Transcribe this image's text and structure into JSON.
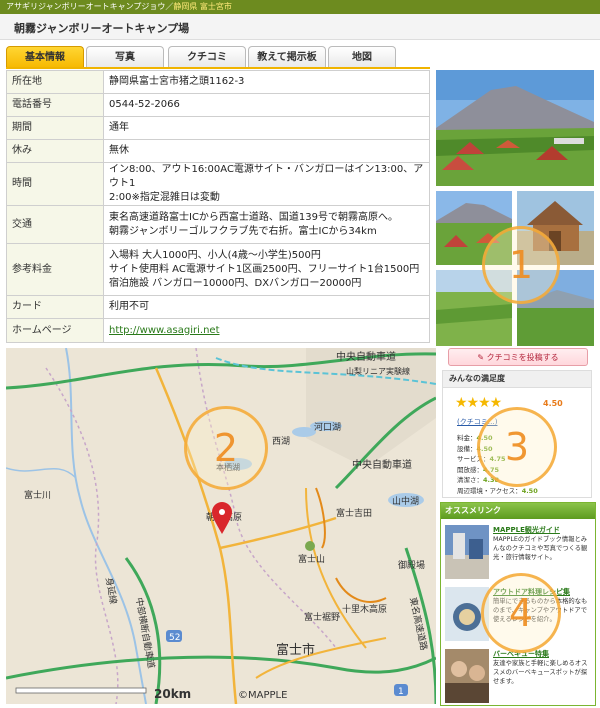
{
  "breadcrumb": {
    "site": "アサギリジャンボリーオートキャンプジョウ",
    "sep": "／",
    "link": "静岡県 富士宮市"
  },
  "page_title": "朝霧ジャンボリーオートキャンプ場",
  "tabs": [
    {
      "label": "基本情報",
      "active": true
    },
    {
      "label": "写真"
    },
    {
      "label": "クチコミ"
    },
    {
      "label": "教えて掲示板"
    },
    {
      "label": "地図"
    }
  ],
  "info": {
    "address_label": "所在地",
    "address_value": "静岡県富士宮市猪之頭1162-3",
    "phone_label": "電話番号",
    "phone_value": "0544-52-2066",
    "period_label": "期間",
    "period_value": "通年",
    "closed_label": "休み",
    "closed_value": "無休",
    "time_label": "時間",
    "time_line1": "イン8:00、アウト16:00AC電源サイト・バンガローはイン13:00、アウト1",
    "time_line2": "2:00※指定混雑日は変動",
    "access_label": "交通",
    "access_line1": "東名高速道路富士ICから西富士道路、国道139号で朝霧高原へ。",
    "access_line2": "朝霧ジャンボリーゴルフクラブ先で右折。富士ICから34km",
    "fee_label": "参考料金",
    "fee_line1": "入場料 大人1000円、小人(4歳～小学生)500円",
    "fee_line2": "サイト使用料 AC電源サイト1区画2500円、フリーサイト1台1500円",
    "fee_line3": "宿泊施設 バンガロー10000円、DXバンガロー20000円",
    "card_label": "カード",
    "card_value": "利用不可",
    "homepage_label": "ホームページ",
    "homepage_value": "http://www.asagiri.net"
  },
  "badges": {
    "one": "1",
    "two": "2",
    "three": "3",
    "four": "4"
  },
  "map": {
    "labels": {
      "chuo_expressway_top": "中央自動車道",
      "maglev": "山梨リニア実験線",
      "minobu_line": "身延線",
      "fujikawa": "富士川",
      "motosu_lake": "本栖湖",
      "saiko": "西湖",
      "kawaguchiko": "河口湖",
      "chuo_expressway": "中央自動車道",
      "yamanakako": "山中湖",
      "fujiyoshida": "富士吉田",
      "asagiri": "朝霧高原",
      "fujisan": "富士山",
      "gotemba": "御殿場",
      "fujisusono": "富士裾野",
      "jukkoku": "十里木高原",
      "chubu_odan": "中部横断自動車道",
      "tomei": "東名高速道路",
      "fuji_city": "富士市",
      "route_52": "52",
      "route_1": "1",
      "route_139": "139",
      "scale": "20km",
      "copyright": "©MAPPLE"
    }
  },
  "post_review_label": "クチコミを投稿する",
  "satisfaction": {
    "title": "みんなの満足度",
    "stars": "★★★★",
    "score": "4.50",
    "link": "(クチコミ…)",
    "rows": [
      {
        "label": "料金：",
        "value": "4.50"
      },
      {
        "label": "設備：",
        "value": "4.50"
      },
      {
        "label": "サービス：",
        "value": "4.75"
      },
      {
        "label": "開放感：",
        "value": "4.75"
      },
      {
        "label": "清潔さ：",
        "value": "4.38"
      },
      {
        "label": "周辺環境・アクセス：",
        "value": "4.50"
      }
    ]
  },
  "recommend": {
    "title": "オススメリンク",
    "items": [
      {
        "title": "MAPPLE観光ガイド",
        "desc": "MAPPLEのガイドブック情報とみんなのクチコミや写真でつくる観光・旅行情報サイト。"
      },
      {
        "title": "アウトドア料理レシピ集",
        "desc": "簡単にできるものから本格的なものまで、キャンプやアウトドアで使えるレシピを紹介。"
      },
      {
        "title": "バーベキュー特集",
        "desc": "友達や家族と手軽に楽しめるオススメのバーベキュースポットが探せます。"
      }
    ]
  },
  "colors": {
    "accent": "#f0b400",
    "topbar": "#6d8b1f",
    "green": "#5d9b1f"
  }
}
